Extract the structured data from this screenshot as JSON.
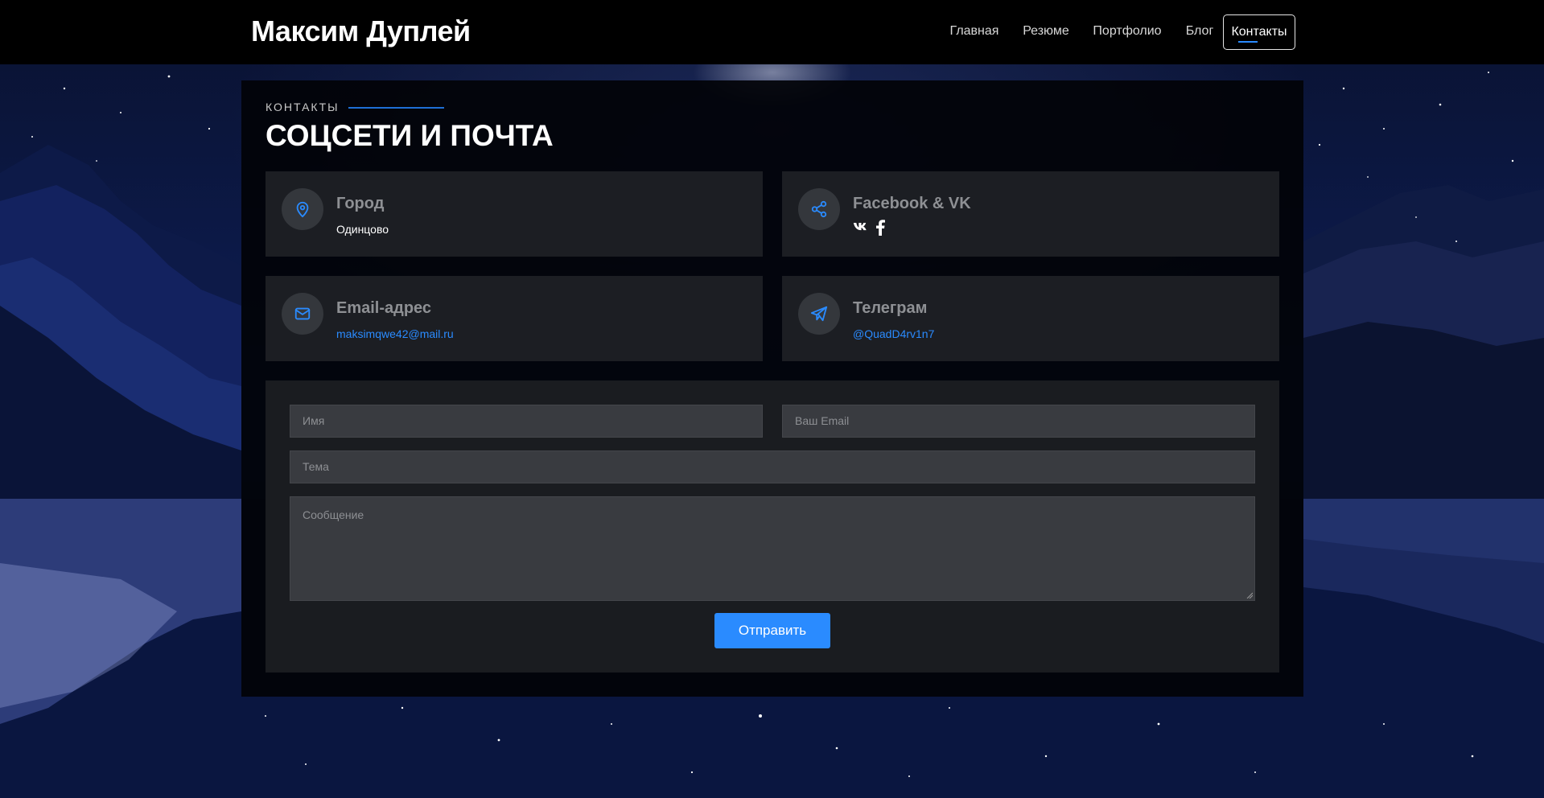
{
  "header": {
    "logo": "Максим Дуплей",
    "nav": [
      {
        "label": "Главная",
        "active": false
      },
      {
        "label": "Резюме",
        "active": false
      },
      {
        "label": "Портфолио",
        "active": false
      },
      {
        "label": "Блог",
        "active": false
      },
      {
        "label": "Контакты",
        "active": true
      }
    ]
  },
  "section": {
    "eyebrow": "КОНТАКТЫ",
    "title": "СОЦСЕТИ И ПОЧТА"
  },
  "cards": {
    "city": {
      "title": "Город",
      "value": "Одинцово",
      "icon": "map-pin-icon"
    },
    "social": {
      "title": "Facebook & VK",
      "icon": "share-icon",
      "links": [
        "vk-icon",
        "facebook-icon"
      ]
    },
    "email": {
      "title": "Email-адрес",
      "value": "maksimqwe42@mail.ru",
      "icon": "envelope-icon"
    },
    "telegram": {
      "title": "Телеграм",
      "value": "@QuadD4rv1n7",
      "icon": "paper-plane-icon"
    }
  },
  "form": {
    "name_placeholder": "Имя",
    "email_placeholder": "Ваш Email",
    "subject_placeholder": "Тема",
    "message_placeholder": "Сообщение",
    "submit_label": "Отправить"
  },
  "colors": {
    "accent": "#2a8bff",
    "header_bg": "#000000",
    "card_bg": "#222428"
  }
}
